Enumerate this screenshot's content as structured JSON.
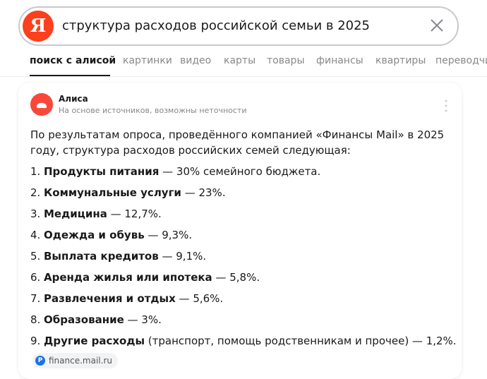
{
  "search": {
    "logo_letter": "Я",
    "query": "структура расходов российской семьи в 2025",
    "logo_color": "#fc3f1d"
  },
  "tabs": [
    {
      "label": "поиск с алисой",
      "active": true
    },
    {
      "label": "картинки",
      "active": false
    },
    {
      "label": "видео",
      "active": false
    },
    {
      "label": "карты",
      "active": false
    },
    {
      "label": "товары",
      "active": false
    },
    {
      "label": "финансы",
      "active": false
    },
    {
      "label": "квартиры",
      "active": false
    },
    {
      "label": "переводчик",
      "active": false
    }
  ],
  "alice": {
    "name": "Алиса",
    "subtitle": "На основе источников, возможны неточности",
    "avatar_color": "#f9483a"
  },
  "answer": {
    "intro": "По результатам опроса, проведённого компанией «Финансы Mail» в 2025 году, структура расходов российских семей следующая:",
    "items": [
      {
        "num": "1.",
        "term": "Продукты питания",
        "rest": " — 30% семейного бюджета."
      },
      {
        "num": "2.",
        "term": "Коммунальные услуги",
        "rest": " — 23%."
      },
      {
        "num": "3.",
        "term": "Медицина",
        "rest": " — 12,7%."
      },
      {
        "num": "4.",
        "term": "Одежда и обувь",
        "rest": " — 9,3%."
      },
      {
        "num": "5.",
        "term": "Выплата кредитов",
        "rest": " — 9,1%."
      },
      {
        "num": "6.",
        "term": "Аренда жилья или ипотека",
        "rest": " — 5,8%."
      },
      {
        "num": "7.",
        "term": "Развлечения и отдых",
        "rest": " — 5,6%."
      },
      {
        "num": "8.",
        "term": "Образование",
        "rest": " — 3%."
      },
      {
        "num": "9.",
        "term": "Другие расходы",
        "rest": " (транспорт, помощь родственникам и прочее) — 1,2%."
      }
    ]
  },
  "source": {
    "favicon_letter": "P",
    "label": "finance.mail.ru"
  }
}
